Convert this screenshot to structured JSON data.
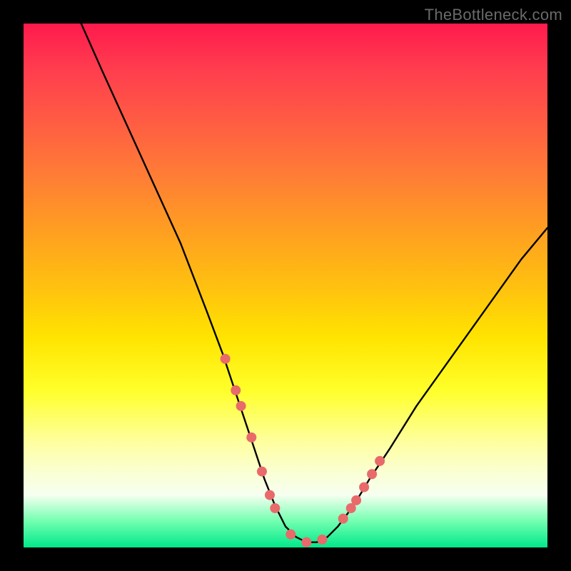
{
  "watermark": "TheBottleneck.com",
  "chart_data": {
    "type": "line",
    "title": "",
    "xlabel": "",
    "ylabel": "",
    "xlim": [
      0,
      100
    ],
    "ylim": [
      0,
      100
    ],
    "series": [
      {
        "name": "curve",
        "x": [
          11,
          15,
          20,
          25,
          30,
          35,
          38,
          40,
          42,
          44,
          46,
          48,
          50,
          52,
          54,
          56,
          58,
          60,
          63,
          66,
          70,
          75,
          80,
          85,
          90,
          95,
          100
        ],
        "values": [
          100,
          91,
          80,
          69,
          58,
          45,
          37,
          31,
          25,
          19,
          13,
          8,
          4,
          2,
          1,
          1,
          2,
          4,
          8,
          13,
          19,
          27,
          34,
          41,
          48,
          55,
          61
        ]
      }
    ],
    "markers": {
      "name": "dots",
      "x": [
        38.5,
        40.5,
        41.5,
        43.5,
        45.5,
        47.0,
        48.0,
        51.0,
        54.0,
        57.0,
        61.0,
        62.5,
        63.5,
        65.0,
        66.5,
        68.0
      ],
      "values": [
        36.0,
        30.0,
        27.0,
        21.0,
        14.5,
        10.0,
        7.5,
        2.5,
        1.0,
        1.5,
        5.5,
        7.5,
        9.0,
        11.5,
        14.0,
        16.5
      ]
    },
    "colors": {
      "curve": "#000000",
      "markers": "#e86a6a"
    }
  }
}
